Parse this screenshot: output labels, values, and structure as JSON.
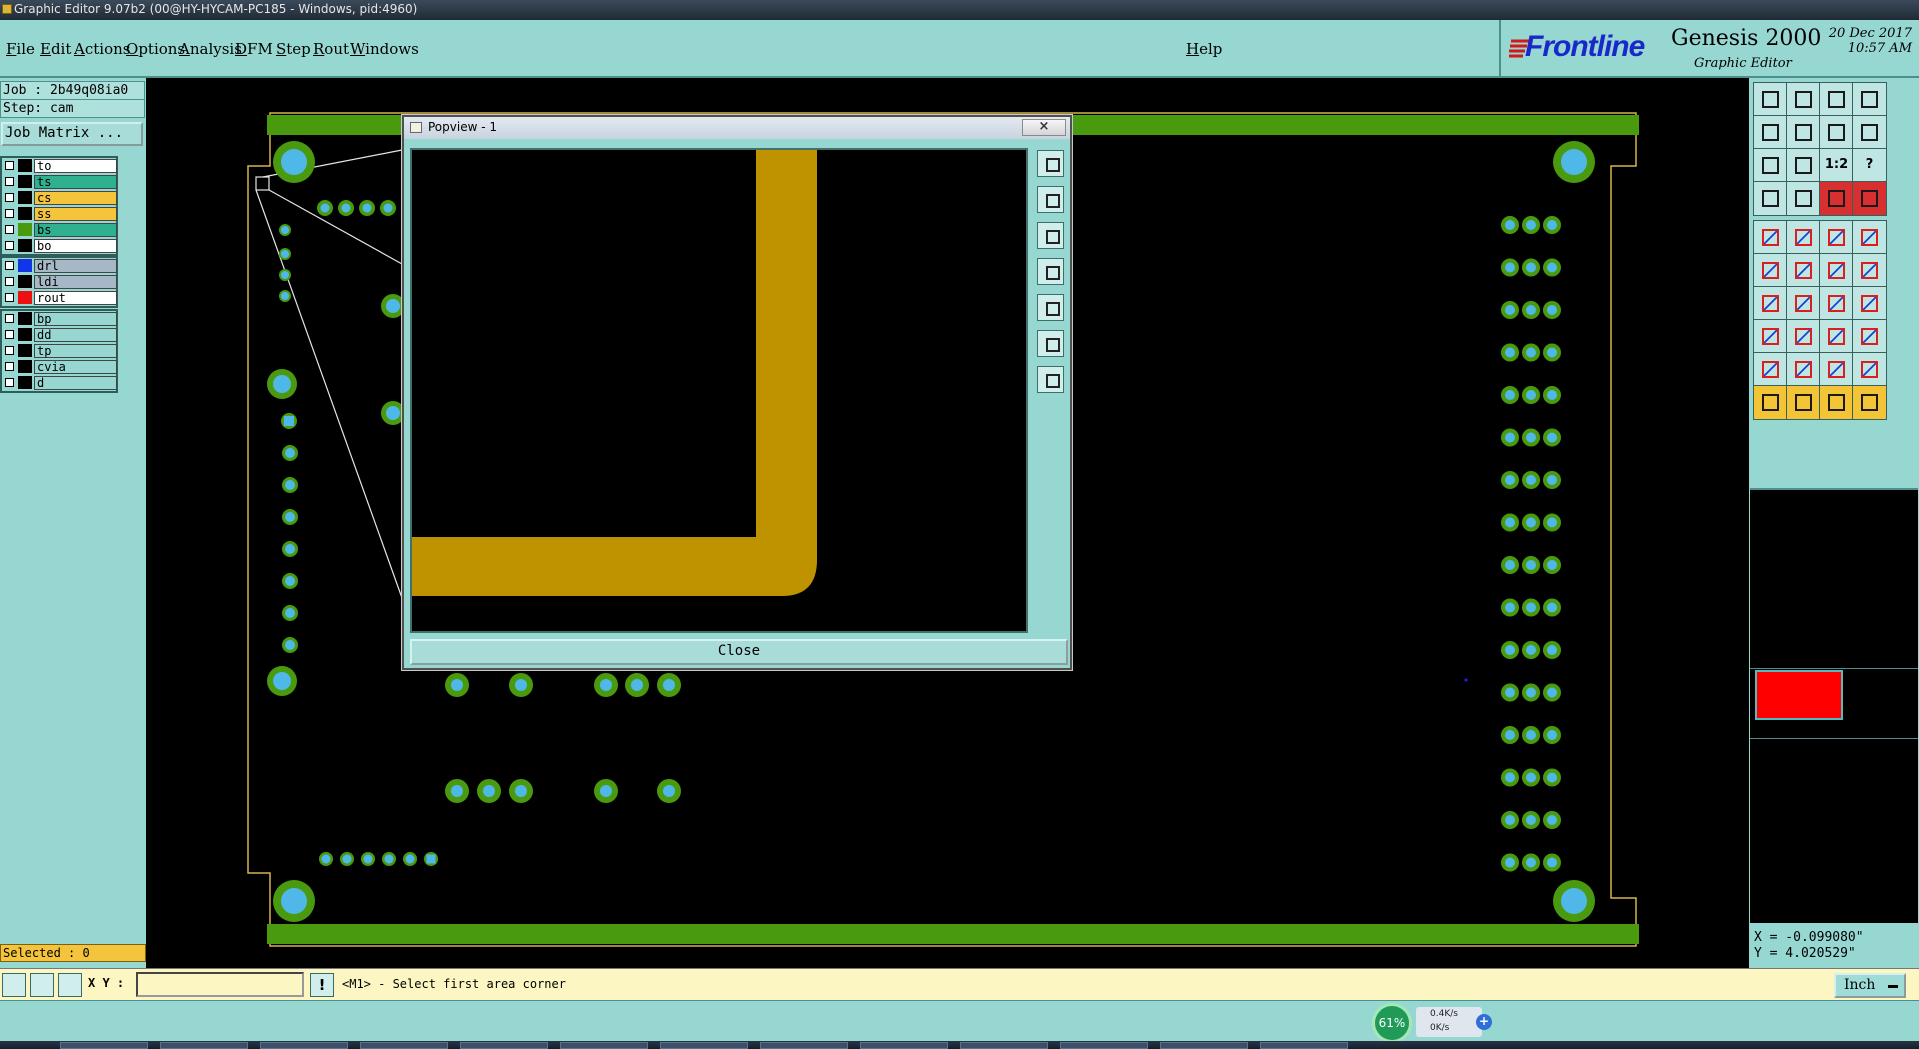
{
  "window": {
    "title": "Graphic Editor 9.07b2 (00@HY-HYCAM-PC185 - Windows, pid:4960)"
  },
  "menu": {
    "items": [
      "File",
      "Edit",
      "Actions",
      "Options",
      "Analysis",
      "DFM",
      "Step",
      "Rout",
      "Windows"
    ],
    "help": "Help"
  },
  "brand": {
    "logo": "Frontline",
    "product": "Genesis 2000",
    "subtitle": "Graphic Editor",
    "date": "20 Dec 2017",
    "time": "10:57 AM"
  },
  "job": {
    "job_line": "Job : 2b49q08ia0",
    "step_line": "Step: cam",
    "matrix_button": "Job Matrix ..."
  },
  "layers": {
    "group1": [
      {
        "name": "to",
        "color": "#ffffff",
        "dot": "#000000"
      },
      {
        "name": "ts",
        "color": "#2fb08e",
        "dot": "#000000"
      },
      {
        "name": "cs",
        "color": "#f4c43c",
        "dot": "#000000"
      },
      {
        "name": "ss",
        "color": "#f4c43c",
        "dot": "#000000"
      },
      {
        "name": "bs",
        "color": "#2fb08e",
        "dot": "#4a9a10"
      },
      {
        "name": "bo",
        "color": "#ffffff",
        "dot": "#000000"
      }
    ],
    "group2": [
      {
        "name": "drl",
        "color": "#a6b7c6",
        "dot": "#1036e8"
      },
      {
        "name": "ldi",
        "color": "#a6b7c6",
        "dot": "#000000"
      },
      {
        "name": "rout",
        "color": "#ffffff",
        "dot": "#ee1010"
      }
    ],
    "group3": [
      {
        "name": "bp",
        "color": "#96d7d2",
        "dot": "#000000"
      },
      {
        "name": "dd",
        "color": "#96d7d2",
        "dot": "#000000"
      },
      {
        "name": "tp",
        "color": "#96d7d2",
        "dot": "#000000"
      },
      {
        "name": "cvia",
        "color": "#96d7d2",
        "dot": "#000000"
      },
      {
        "name": "d",
        "color": "#96d7d2",
        "dot": "#000000"
      }
    ],
    "selected_label": "Selected : 0"
  },
  "popview": {
    "title": "Popview - 1",
    "close_x": "×",
    "close_button": "Close",
    "tools": [
      "zoom-home-icon",
      "zoom-in-icon",
      "zoom-out-icon",
      "pan-left-icon",
      "pan-right-icon",
      "fit-icon",
      "fit-all-icon"
    ]
  },
  "coords": {
    "x": "X = -0.099080\"",
    "y": "Y = 4.020529\""
  },
  "tools_grid": [
    [
      "export-icon",
      "import-icon",
      "home-icon",
      "window-icon"
    ],
    [
      "pan-left-icon",
      "pan-right-icon",
      "flip-icon",
      "redo-icon"
    ],
    [
      "zoom-fit-icon",
      "zoom-area-icon",
      "ratio-icon",
      "query-icon"
    ],
    [
      "snap-icon",
      "grid-icon",
      "drc-icon",
      "drc-alt-icon"
    ],
    [
      "pad-icon",
      "line-icon",
      "measure-icon",
      "stop-icon"
    ],
    [
      "connect-icon",
      "cross-icon",
      "segment-icon",
      "segment-alt-icon"
    ],
    [
      "angle-icon",
      "slash-icon",
      "arc-icon",
      "font-icon"
    ],
    [
      "pad-move-icon",
      "bar-icon",
      "resize-icon",
      "duplicate-icon"
    ],
    [
      "triangle-icon",
      "peak-icon",
      "apex-icon",
      "outline-icon"
    ],
    [
      "pointer-icon",
      "pointer-select-icon",
      "pointer-area-icon",
      "pointer-multi-icon"
    ]
  ],
  "ratio_label": "1:2",
  "query_label": "?",
  "command": {
    "xy_label": "X Y :",
    "input_value": "",
    "warn_glyph": "!",
    "message": "<M1> - Select first area corner",
    "unit": "Inch"
  },
  "net": {
    "percent": "61%",
    "up": "0.4K/s",
    "down": "0K/s",
    "plus": "+"
  },
  "colors": {
    "panel": "#96d7d2",
    "trace": "#bf9300",
    "pad_ring": "#4a9a10",
    "pad_hole": "#4fb8e8",
    "outline": "#d6b54a"
  }
}
